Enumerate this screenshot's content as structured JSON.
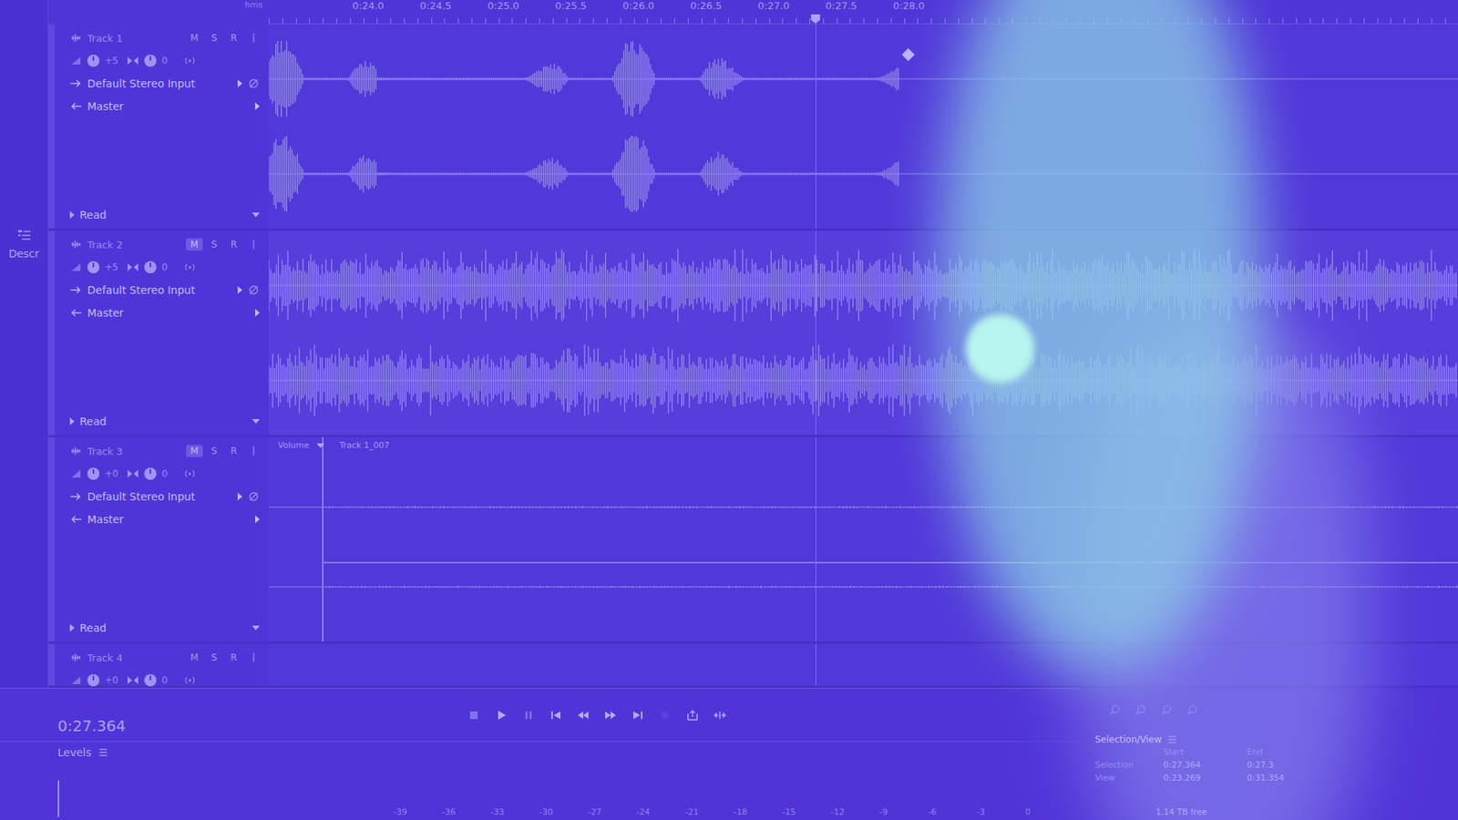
{
  "ruler": {
    "unit": "hms",
    "ticks": [
      "0:24.0",
      "0:24.5",
      "0:25.0",
      "0:25.5",
      "0:26.0",
      "0:26.5",
      "0:27.0",
      "0:27.5",
      "0:28.0"
    ]
  },
  "side_panel": {
    "label": "Descr"
  },
  "tracks": [
    {
      "name": "Track 1",
      "kind": "speech",
      "buttons": [
        {
          "label": "M",
          "on": false
        },
        {
          "label": "S",
          "on": false
        },
        {
          "label": "R",
          "on": false
        }
      ],
      "volume": "+5",
      "pan": "0",
      "input": "Default Stereo Input",
      "output": "Master",
      "automation": "Read"
    },
    {
      "name": "Track 2",
      "kind": "music",
      "buttons": [
        {
          "label": "M",
          "on": true
        },
        {
          "label": "S",
          "on": false
        },
        {
          "label": "R",
          "on": false
        }
      ],
      "volume": "+5",
      "pan": "0",
      "input": "Default Stereo Input",
      "output": "Master",
      "automation": "Read"
    },
    {
      "name": "Track 3",
      "kind": "envelope",
      "buttons": [
        {
          "label": "M",
          "on": true
        },
        {
          "label": "S",
          "on": false
        },
        {
          "label": "R",
          "on": false
        }
      ],
      "volume": "+0",
      "pan": "0",
      "input": "Default Stereo Input",
      "output": "Master",
      "automation": "Read",
      "clip": {
        "envelope": "Volume",
        "name": "Track 1_007"
      }
    },
    {
      "name": "Track 4",
      "kind": "empty",
      "buttons": [
        {
          "label": "M",
          "on": false
        },
        {
          "label": "S",
          "on": false
        },
        {
          "label": "R",
          "on": false
        }
      ],
      "volume": "+0",
      "pan": "0"
    }
  ],
  "transport": {
    "time": "0:27.364"
  },
  "levels": {
    "title": "Levels",
    "ticks": [
      "-39",
      "-36",
      "-33",
      "-30",
      "-27",
      "-24",
      "-21",
      "-18",
      "-15",
      "-12",
      "-9",
      "-6",
      "-3",
      "0"
    ]
  },
  "selection_view": {
    "title": "Selection/View",
    "columns": [
      "Start",
      "End"
    ],
    "rows": [
      {
        "label": "Selection",
        "start": "0:27.364",
        "end": "0:27.3"
      },
      {
        "label": "View",
        "start": "0:23.269",
        "end": "0:31.354"
      }
    ]
  },
  "status_bar": {
    "free_space": "1.14 TB free"
  }
}
